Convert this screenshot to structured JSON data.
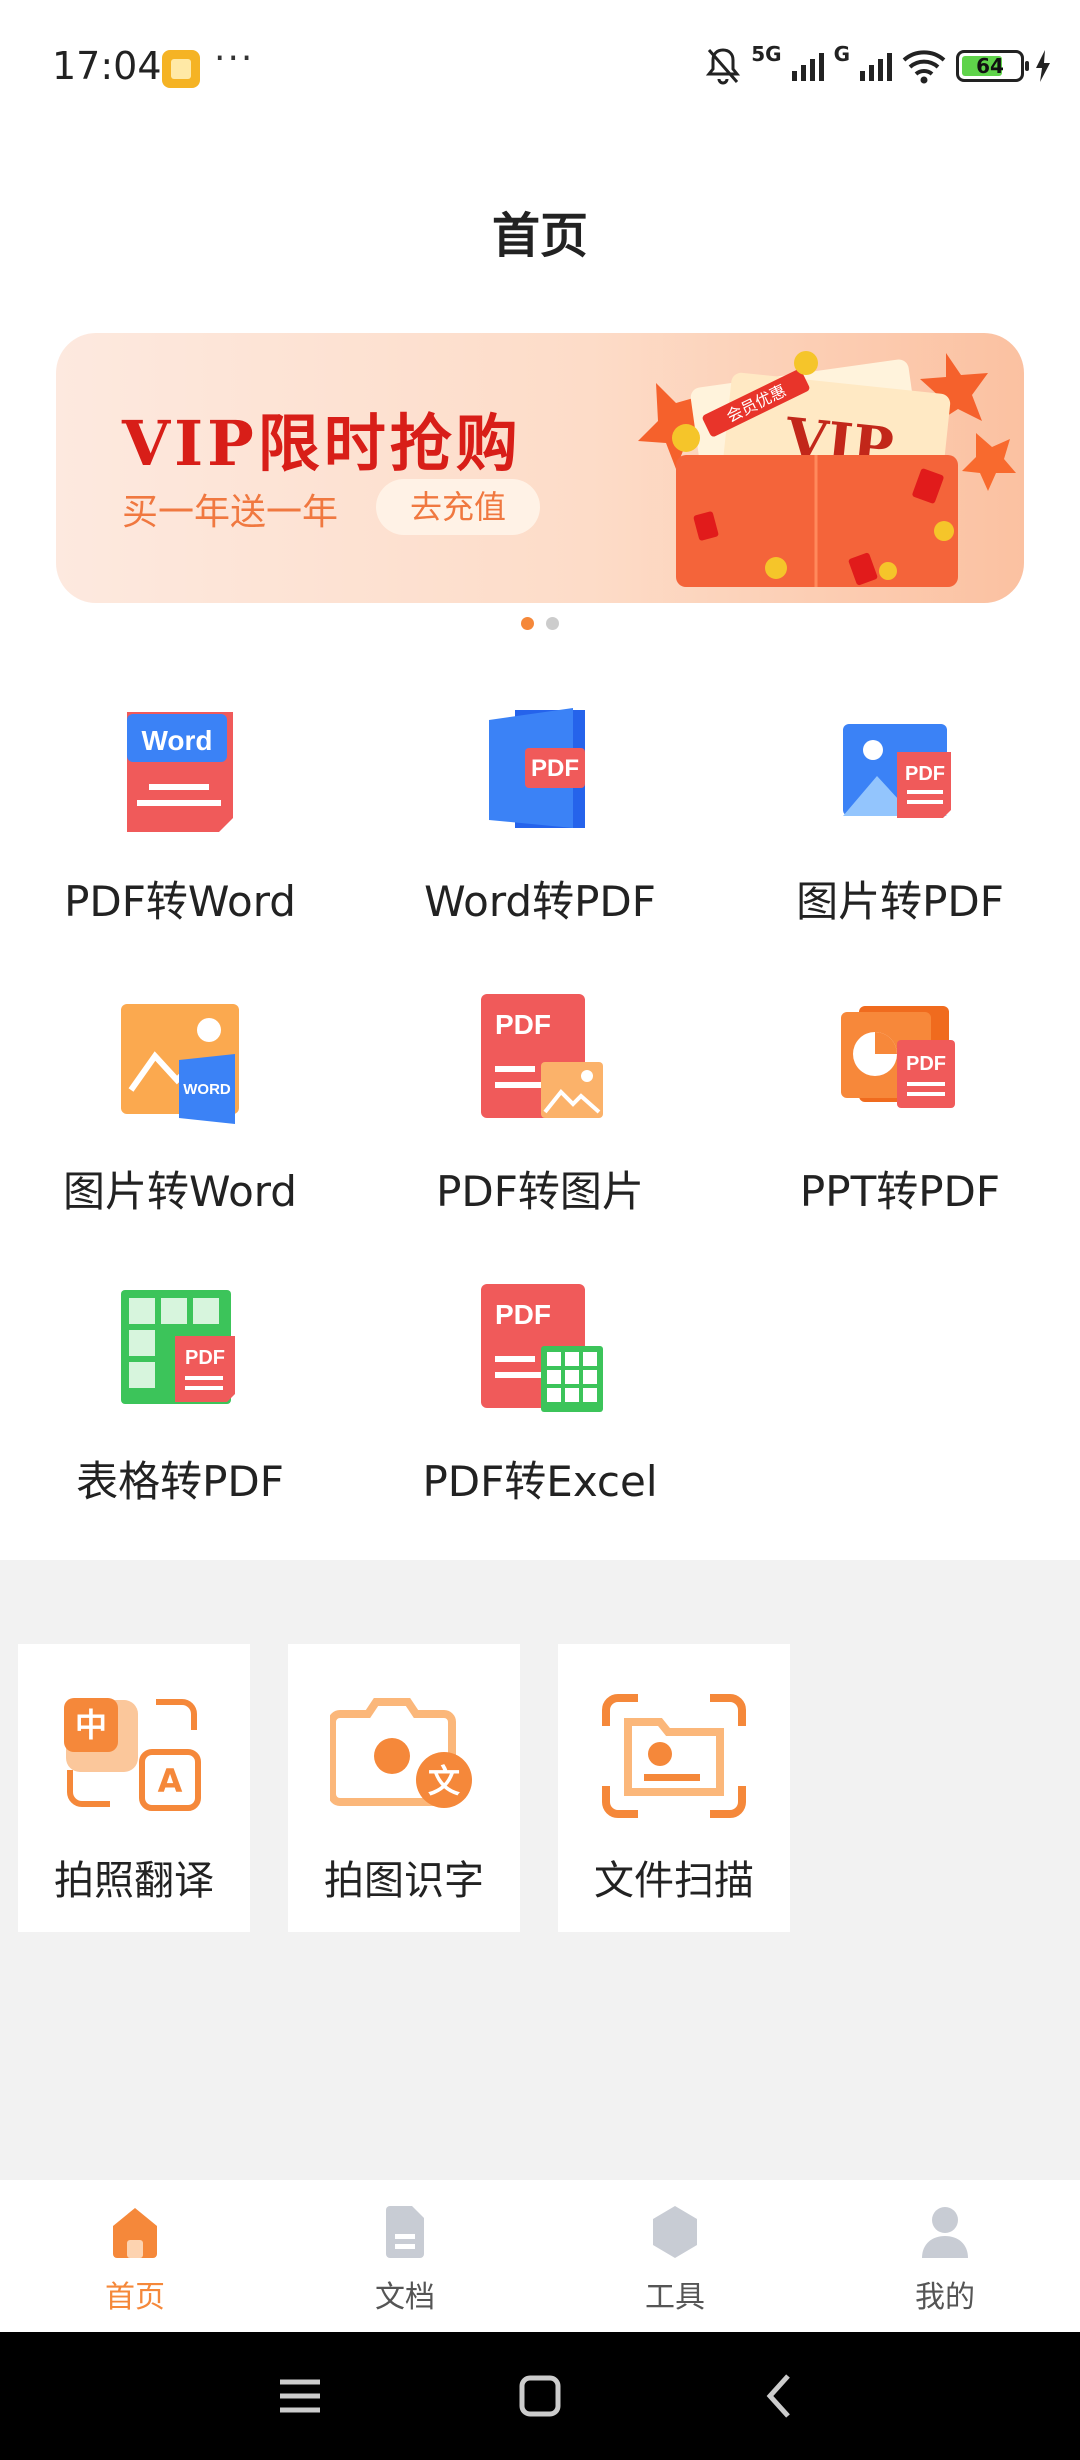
{
  "status_bar": {
    "time": "17:04",
    "more": "···",
    "network_1": "5G",
    "network_2": "G",
    "battery": "64",
    "icons": [
      "app-notification-icon",
      "mute-icon",
      "signal-icon",
      "wifi-icon",
      "battery-icon",
      "charging-icon"
    ]
  },
  "header": {
    "title": "首页"
  },
  "banner": {
    "title": "VIP限时抢购",
    "subtitle": "买一年送一年",
    "button": "去充值",
    "art_text": "VIP",
    "ribbon": "会员优惠",
    "page_count": 2,
    "active_page": 1
  },
  "functions": [
    {
      "label": "PDF转Word",
      "icon": "pdf-to-word-icon",
      "badge": "Word"
    },
    {
      "label": "Word转PDF",
      "icon": "word-to-pdf-icon",
      "badge": "PDF"
    },
    {
      "label": "图片转PDF",
      "icon": "image-to-pdf-icon",
      "badge": "PDF"
    },
    {
      "label": "图片转Word",
      "icon": "image-to-word-icon",
      "badge": "WORD"
    },
    {
      "label": "PDF转图片",
      "icon": "pdf-to-image-icon",
      "badge": "PDF"
    },
    {
      "label": "PPT转PDF",
      "icon": "ppt-to-pdf-icon",
      "badge": "PDF"
    },
    {
      "label": "表格转PDF",
      "icon": "sheet-to-pdf-icon",
      "badge": "PDF"
    },
    {
      "label": "PDF转Excel",
      "icon": "pdf-to-excel-icon",
      "badge": "PDF"
    }
  ],
  "tools": [
    {
      "label": "拍照翻译",
      "icon": "photo-translate-icon",
      "glyph_1": "中",
      "glyph_2": "A"
    },
    {
      "label": "拍图识字",
      "icon": "photo-ocr-icon",
      "glyph_1": "文"
    },
    {
      "label": "文件扫描",
      "icon": "file-scan-icon"
    }
  ],
  "bottom_nav": {
    "items": [
      {
        "label": "首页",
        "icon": "home-icon",
        "active": true
      },
      {
        "label": "文档",
        "icon": "document-icon",
        "active": false
      },
      {
        "label": "工具",
        "icon": "tools-icon",
        "active": false
      },
      {
        "label": "我的",
        "icon": "profile-icon",
        "active": false
      }
    ]
  },
  "system_nav": {
    "icons": [
      "menu-icon",
      "home-square-icon",
      "back-icon"
    ]
  },
  "colors": {
    "accent": "#f5883a",
    "pdf_red": "#f05a5a",
    "word_blue": "#3b82f6",
    "excel_green": "#3cc45a",
    "banner_red": "#d81e18",
    "tools_bg": "#f2f2f2"
  }
}
